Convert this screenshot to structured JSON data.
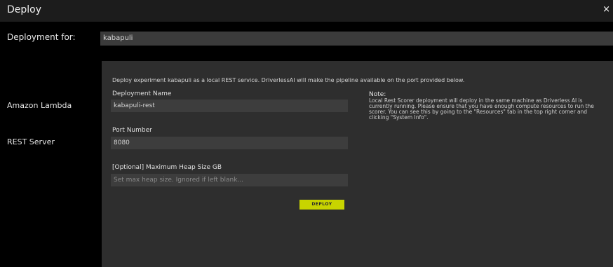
{
  "window": {
    "title": "Deploy",
    "close_glyph": "×"
  },
  "deployment_for": {
    "label": "Deployment for:",
    "value": "kabapuli"
  },
  "targets": [
    "Amazon Lambda",
    "REST Server"
  ],
  "form": {
    "intro": "Deploy experiment kabapuli as a local REST service. DriverlessAI will make the pipeline available on the port provided below.",
    "deployment_name": {
      "label": "Deployment Name",
      "value": "kabapuli-rest"
    },
    "port_number": {
      "label": "Port Number",
      "value": "8080"
    },
    "heap_size": {
      "label": "[Optional] Maximum Heap Size GB",
      "placeholder": "Set max heap size. Ignored if left blank..."
    },
    "deploy_label": "DEPLOY"
  },
  "note": {
    "title": "Note:",
    "text": "Local Rest Scorer deployment will deploy in the same machine as Driverless AI is currently running. Please ensure that you have enough compute resources to run the scorer. You can see this by going to the \"Resources\" tab in the top right corner and clicking \"System Info\"."
  },
  "colors": {
    "accent": "#c8d400",
    "background": "#000000",
    "panel": "#2e2e2e"
  }
}
